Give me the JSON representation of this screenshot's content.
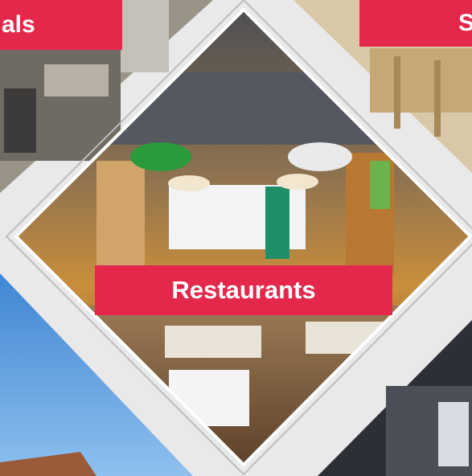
{
  "tiles": {
    "left": {
      "label": "als"
    },
    "right": {
      "label": "S"
    },
    "center": {
      "label": "Restaurants"
    }
  },
  "colors": {
    "label_bg": "#e3284b",
    "label_text": "#ffffff",
    "panel": "#e9e9ea"
  }
}
